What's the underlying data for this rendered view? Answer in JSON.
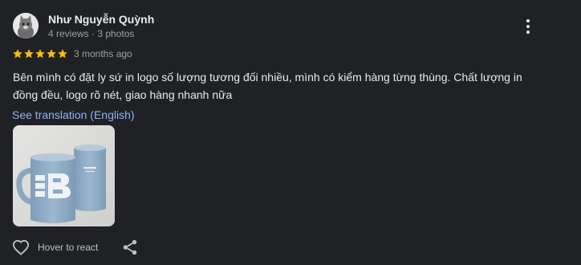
{
  "reviewer": {
    "name": "Như Nguyễn Quỳnh",
    "meta": "4 reviews · 3 photos",
    "avatar_icon": "cat-avatar"
  },
  "review": {
    "rating": 5,
    "rating_max": 5,
    "time": "3 months ago",
    "text": "Bên mình có đặt ly sứ in logo số lượng tương đối nhiều, mình có kiểm hàng từng thùng. Chất lượng in đồng đều, logo rõ nét, giao hàng nhanh nữa",
    "translate_link": "See translation (English)",
    "photo_description_icon": "mug-photo"
  },
  "actions": {
    "react_label": "Hover to react",
    "react_icon": "heart-outline-icon",
    "share_icon": "share-icon",
    "more_icon": "more-vertical-icon"
  },
  "colors": {
    "background": "#202124",
    "star": "#fbbc04",
    "link": "#8ab4f8",
    "text_primary": "#e8eaed",
    "text_secondary": "#9aa0a6"
  }
}
